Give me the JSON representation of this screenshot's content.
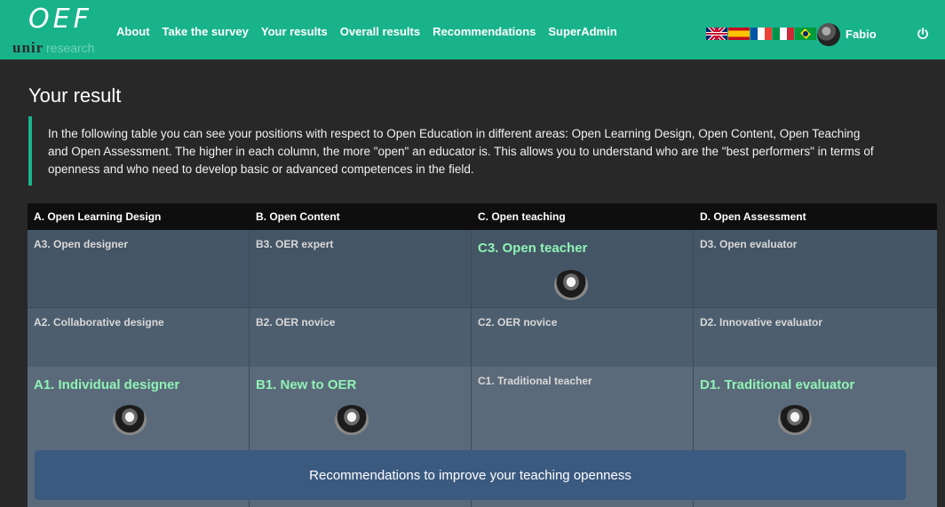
{
  "header": {
    "logo": {
      "main": "OEF",
      "brand": "unir",
      "brand_suffix": "research"
    },
    "nav": [
      "About",
      "Take the survey",
      "Your results",
      "Overall results",
      "Recommendations",
      "SuperAdmin"
    ],
    "user_name": "Fabio",
    "languages": [
      "uk-flag-icon",
      "es-flag-icon",
      "fr-flag-icon",
      "it-flag-icon",
      "br-flag-icon"
    ],
    "accent_color": "#19b38b"
  },
  "page": {
    "title": "Your result",
    "intro": "In the following table you can see your positions with respect to Open Education in different areas: Open Learning Design, Open Content, Open Teaching and Open Assessment. The higher in each column, the more \"open\" an educator is. This allows you to understand who are the \"best performers\" in terms of openness and who need to develop basic or advanced competences in the field."
  },
  "table": {
    "headers": [
      "A. Open Learning Design",
      "B. Open Content",
      "C. Open teaching",
      "D. Open Assessment"
    ],
    "rows": [
      [
        "A3. Open designer",
        "B3. OER expert",
        "C3. Open teacher",
        "D3. Open evaluator"
      ],
      [
        "A2. Collaborative designe",
        "B2. OER novice",
        "C2. OER novice",
        "D2. Innovative evaluator"
      ],
      [
        "A1. Individual designer",
        "B1. New to OER",
        "C1. Traditional teacher",
        "D1. Traditional evaluator"
      ]
    ],
    "highlight_color": "#8ff3b5"
  },
  "recommendation_button": "Recommendations to improve your teaching openness"
}
